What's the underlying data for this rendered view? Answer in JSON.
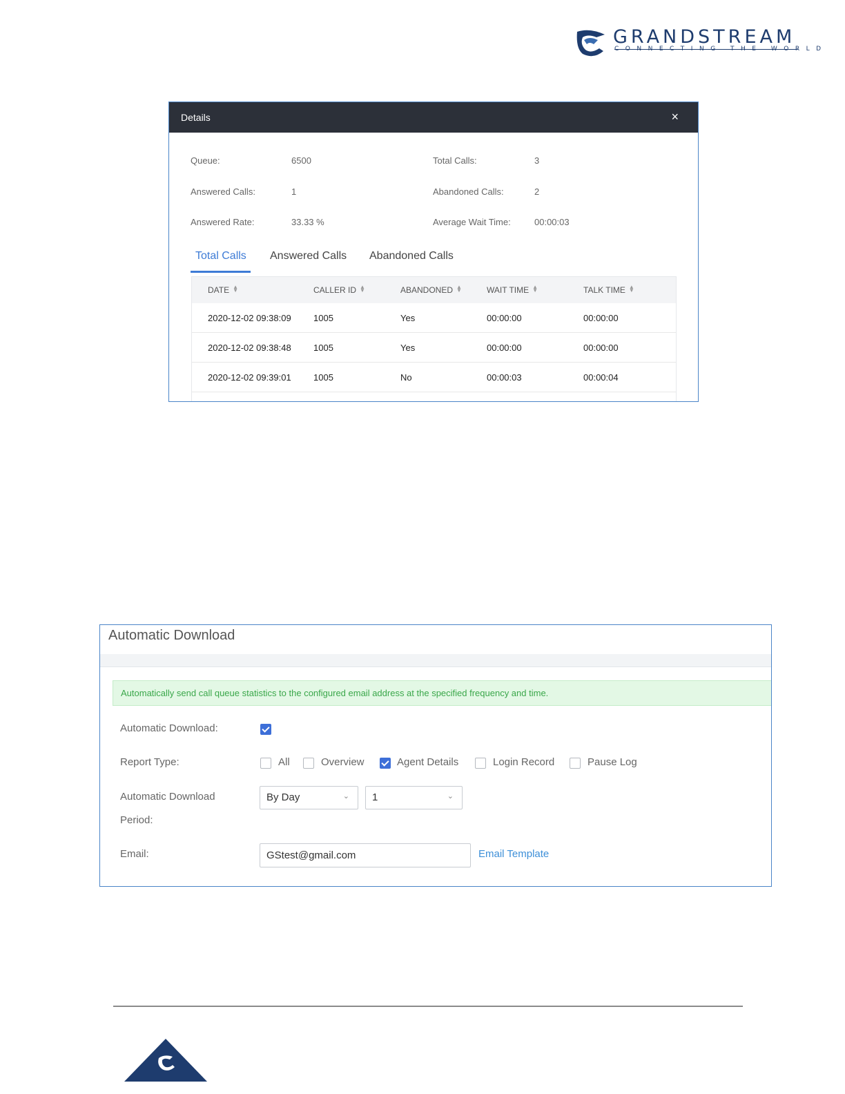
{
  "brand": {
    "name": "GRANDSTREAM",
    "tagline": "CONNECTING THE WORLD",
    "color": "#1e3c6e",
    "icon": "grandstream-logo-icon"
  },
  "details_dialog": {
    "title": "Details",
    "close_icon": "×",
    "stats": {
      "queue_label": "Queue:",
      "queue_value": "6500",
      "total_calls_label": "Total Calls:",
      "total_calls_value": "3",
      "answered_calls_label": "Answered Calls:",
      "answered_calls_value": "1",
      "abandoned_calls_label": "Abandoned Calls:",
      "abandoned_calls_value": "2",
      "answered_rate_label": "Answered Rate:",
      "answered_rate_value": "33.33 %",
      "avg_wait_label": "Average Wait Time:",
      "avg_wait_value": "00:00:03"
    },
    "tabs": [
      {
        "label": "Total Calls",
        "active": true
      },
      {
        "label": "Answered Calls",
        "active": false
      },
      {
        "label": "Abandoned Calls",
        "active": false
      }
    ],
    "table": {
      "columns": [
        "DATE",
        "CALLER ID",
        "ABANDONED",
        "WAIT TIME",
        "TALK TIME"
      ],
      "rows": [
        [
          "2020-12-02 09:38:09",
          "1005",
          "Yes",
          "00:00:00",
          "00:00:00"
        ],
        [
          "2020-12-02 09:38:48",
          "1005",
          "Yes",
          "00:00:00",
          "00:00:00"
        ],
        [
          "2020-12-02 09:39:01",
          "1005",
          "No",
          "00:00:03",
          "00:00:04"
        ]
      ]
    },
    "accent_color": "#3d7bd6",
    "header_color": "#2c3039"
  },
  "auto_download": {
    "title": "Automatic Download",
    "notice": "Automatically send call queue statistics to the configured email address at the specified frequency and time.",
    "automatic_download_label": "Automatic Download:",
    "automatic_download_checked": true,
    "report_type_label": "Report Type:",
    "report_types": [
      {
        "label": "All",
        "checked": false
      },
      {
        "label": "Overview",
        "checked": false
      },
      {
        "label": "Agent Details",
        "checked": true
      },
      {
        "label": "Login Record",
        "checked": false
      },
      {
        "label": "Pause Log",
        "checked": false
      }
    ],
    "period_label_line1": "Automatic Download",
    "period_label_line2": "Period:",
    "period_unit_value": "By Day",
    "period_count_value": "1",
    "email_label": "Email:",
    "email_value": "GStest@gmail.com",
    "email_template_link": "Email Template",
    "notice_color": "#3aa74a",
    "link_color": "#3d8fd8"
  }
}
